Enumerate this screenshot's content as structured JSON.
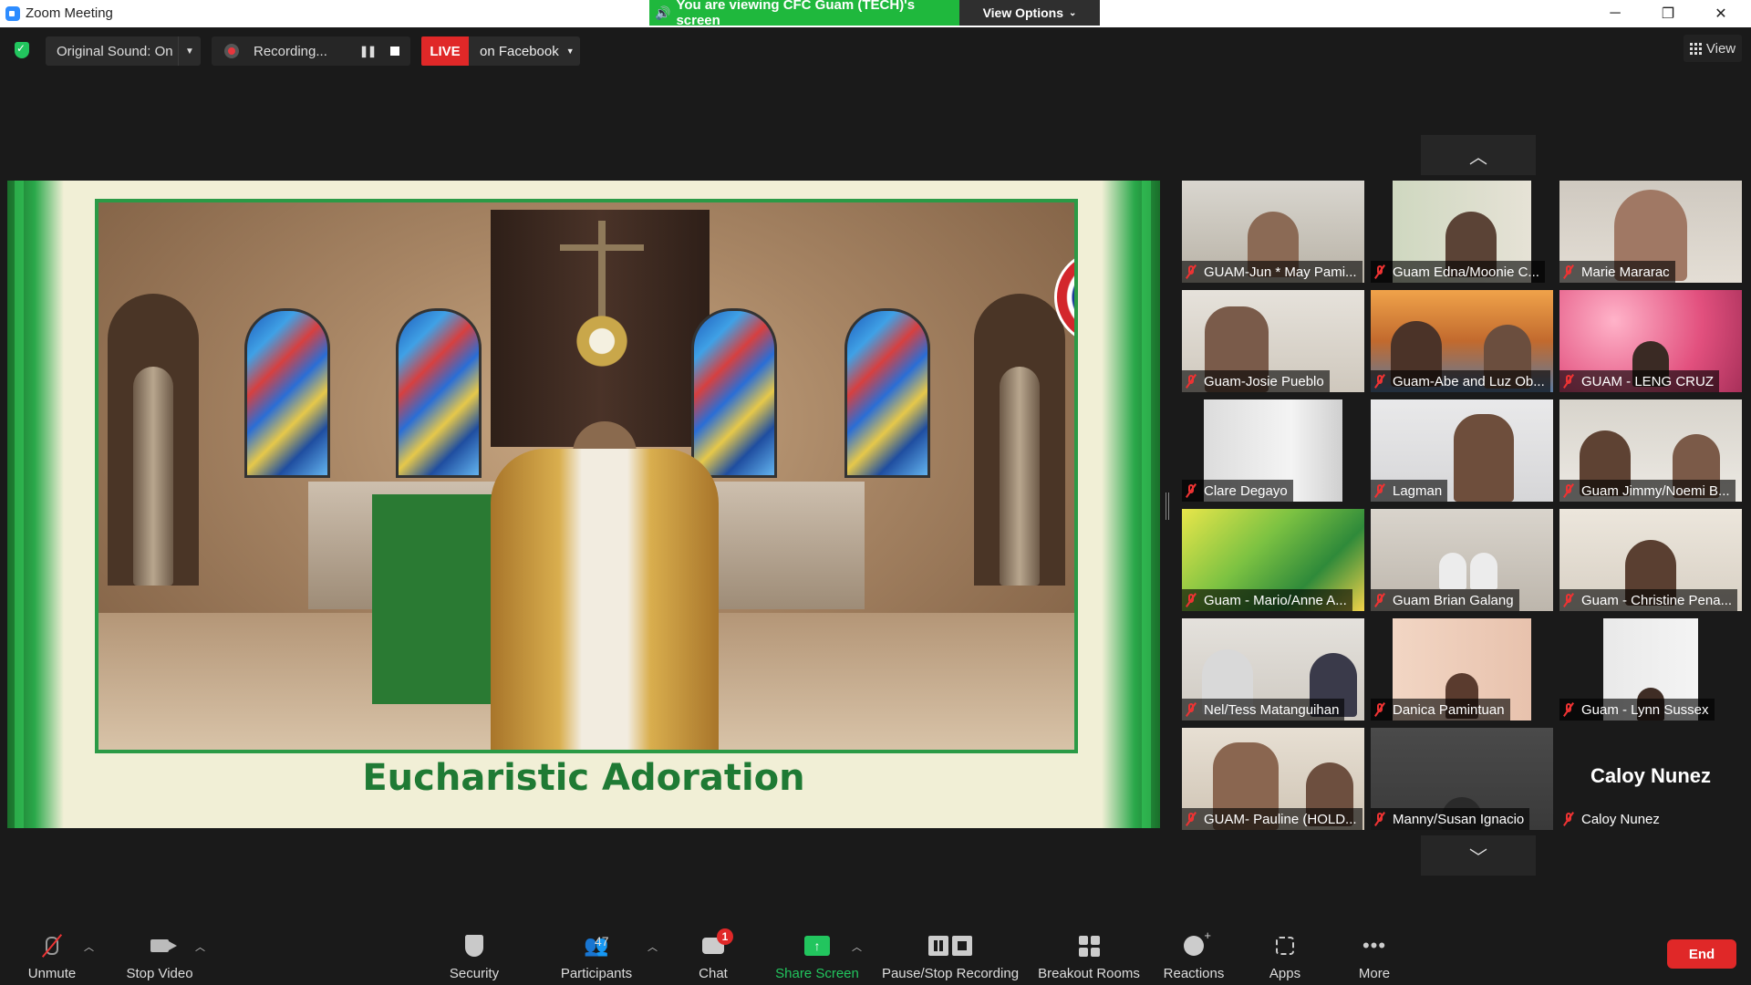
{
  "window": {
    "title": "Zoom Meeting",
    "share_banner": "You are viewing CFC Guam (TECH)'s screen",
    "view_options": "View Options",
    "controls": [
      "minimize",
      "restore",
      "close"
    ]
  },
  "topbar": {
    "original_sound": "Original Sound: On",
    "recording_label": "Recording...",
    "live_label": "LIVE",
    "live_destination": "on Facebook",
    "view_label": "View"
  },
  "shared_screen": {
    "slide_title": "Eucharistic Adoration",
    "colors": {
      "frame_green": "#2aa84a",
      "title_green": "#1f7a34"
    }
  },
  "gallery": {
    "tiles": [
      {
        "name": "GUAM-Jun * May Pami...",
        "muted": true,
        "video": true
      },
      {
        "name": "Guam Edna/Moonie C...",
        "muted": true,
        "video": true
      },
      {
        "name": "Marie Mararac",
        "muted": true,
        "video": true
      },
      {
        "name": "Guam-Josie Pueblo",
        "muted": true,
        "video": true
      },
      {
        "name": "Guam-Abe and Luz Ob...",
        "muted": true,
        "video": true
      },
      {
        "name": "GUAM - LENG CRUZ",
        "muted": true,
        "video": true
      },
      {
        "name": "Clare Degayo",
        "muted": true,
        "video": true
      },
      {
        "name": "Lagman",
        "muted": true,
        "video": true
      },
      {
        "name": "Guam Jimmy/Noemi B...",
        "muted": true,
        "video": true
      },
      {
        "name": "Guam - Mario/Anne A...",
        "muted": true,
        "video": true
      },
      {
        "name": "Guam Brian Galang",
        "muted": true,
        "video": true
      },
      {
        "name": "Guam - Christine Pena...",
        "muted": true,
        "video": true
      },
      {
        "name": "Nel/Tess Matanguihan",
        "muted": true,
        "video": true
      },
      {
        "name": "Danica Pamintuan",
        "muted": true,
        "video": true
      },
      {
        "name": "Guam - Lynn Sussex",
        "muted": true,
        "video": true
      },
      {
        "name": "GUAM- Pauline (HOLD...",
        "muted": true,
        "video": true
      },
      {
        "name": "Manny/Susan Ignacio",
        "muted": true,
        "video": true
      },
      {
        "name": "Caloy Nunez",
        "muted": true,
        "video": false,
        "display_name": "Caloy Nunez"
      }
    ]
  },
  "toolbar": {
    "unmute": "Unmute",
    "stop_video": "Stop Video",
    "security": "Security",
    "participants": "Participants",
    "participants_count": "47",
    "chat": "Chat",
    "chat_badge": "1",
    "share_screen": "Share Screen",
    "pause_stop_recording": "Pause/Stop Recording",
    "breakout_rooms": "Breakout Rooms",
    "reactions": "Reactions",
    "apps": "Apps",
    "more": "More",
    "end": "End"
  }
}
